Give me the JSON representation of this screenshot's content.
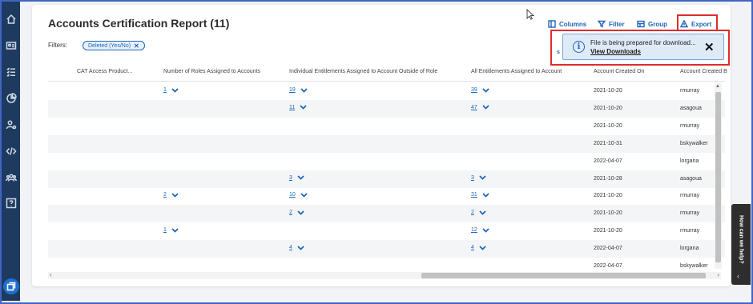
{
  "report": {
    "title": "Accounts Certification Report (11)"
  },
  "toolbar": {
    "columns_label": "Columns",
    "filter_label": "Filter",
    "group_label": "Group",
    "export_label": "Export"
  },
  "filters": {
    "label": "Filters:",
    "chip_label": "Deleted (Yes/No)",
    "chip_close": "✕"
  },
  "stray_text": "s",
  "toast": {
    "message": "File is being prepared for download...",
    "link": "View Downloads",
    "close": "✕",
    "icon": "info-icon"
  },
  "table": {
    "headers": [
      "CAT Access Product...",
      "Number of Roles Assigned to Accounts",
      "Individual Entitlements Assigned to Account Outside of Role",
      "All Entitlements Assigned to Account",
      "Account Created On",
      "Account Created B"
    ],
    "rows": [
      {
        "roles": "1",
        "individual": "19",
        "all": "39",
        "created_on": "2021-10-20",
        "created_by": "rmurray"
      },
      {
        "roles": "",
        "individual": "11",
        "all": "47",
        "created_on": "2021-10-20",
        "created_by": "asagoua"
      },
      {
        "roles": "",
        "individual": "",
        "all": "",
        "created_on": "2021-10-20",
        "created_by": "rmurray"
      },
      {
        "roles": "",
        "individual": "",
        "all": "",
        "created_on": "2021-10-31",
        "created_by": "bskywalker"
      },
      {
        "roles": "",
        "individual": "",
        "all": "",
        "created_on": "2022-04-07",
        "created_by": "lorgana"
      },
      {
        "roles": "",
        "individual": "3",
        "all": "3",
        "created_on": "2021-10-28",
        "created_by": "asagoua"
      },
      {
        "roles": "2",
        "individual": "10",
        "all": "31",
        "created_on": "2021-10-20",
        "created_by": "rmurray"
      },
      {
        "roles": "",
        "individual": "2",
        "all": "2",
        "created_on": "2021-10-20",
        "created_by": "rmurray"
      },
      {
        "roles": "1",
        "individual": "",
        "all": "12",
        "created_on": "2021-10-20",
        "created_by": "rmurray"
      },
      {
        "roles": "",
        "individual": "4",
        "all": "4",
        "created_on": "2022-04-07",
        "created_by": "lorgana"
      },
      {
        "roles": "",
        "individual": "",
        "all": "",
        "created_on": "2022-04-07",
        "created_by": "bskywalker"
      }
    ]
  },
  "help": {
    "label": "How can we help?",
    "chevron": "‹"
  },
  "scroll": {
    "left": "‹",
    "right": "›",
    "up": "▲"
  },
  "sidebar": {
    "icons": [
      "home-icon",
      "id-card-icon",
      "checklist-icon",
      "pie-chart-icon",
      "user-settings-icon",
      "code-icon",
      "group-icon",
      "help-box-icon"
    ],
    "bottom_icon": "windows-icon"
  },
  "colors": {
    "accent": "#1f66b8",
    "sidebar": "#1e3a5f",
    "highlight": "#e02c2c"
  }
}
